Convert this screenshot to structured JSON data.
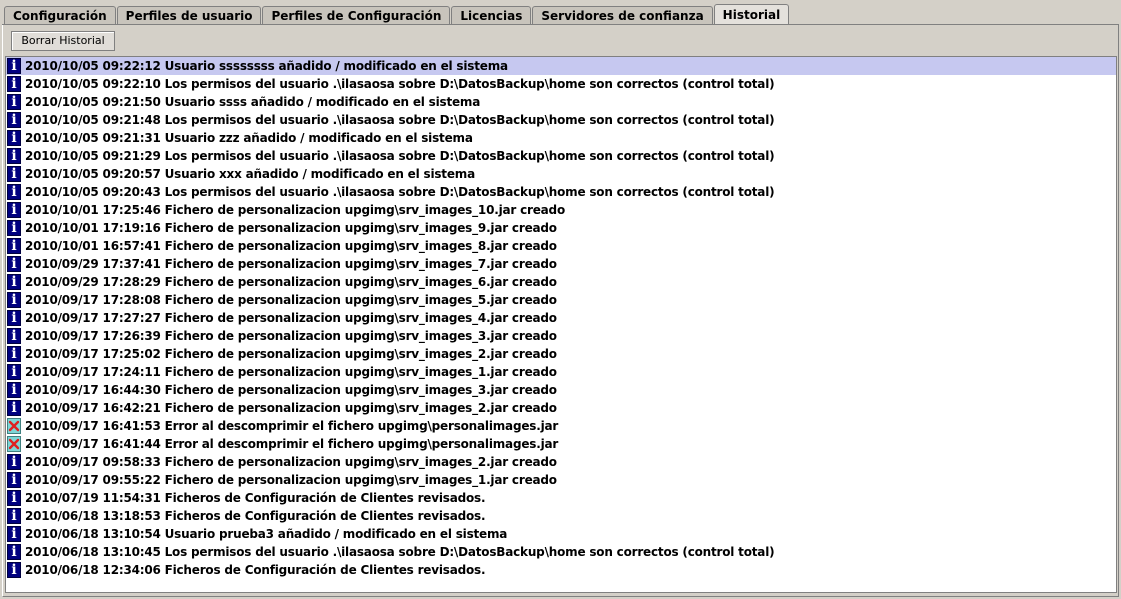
{
  "tabs": [
    {
      "label": "Configuración",
      "active": false
    },
    {
      "label": "Perfiles de usuario",
      "active": false
    },
    {
      "label": "Perfiles de Configuración",
      "active": false
    },
    {
      "label": "Licencias",
      "active": false
    },
    {
      "label": "Servidores de confianza",
      "active": false
    },
    {
      "label": "Historial",
      "active": true
    }
  ],
  "toolbar": {
    "clear_label": "Borrar Historial"
  },
  "icons": {
    "info": "info-icon",
    "error": "error-icon"
  },
  "colors": {
    "info_bg": "#000080",
    "error_bg": "#7ed6d6",
    "error_x": "#e02020",
    "selection": "#c6c8f0"
  },
  "log": [
    {
      "type": "info",
      "text": "2010/10/05 09:22:12 Usuario ssssssss añadido / modificado en el sistema",
      "selected": true
    },
    {
      "type": "info",
      "text": "2010/10/05 09:22:10 Los permisos del usuario .\\ilasaosa sobre D:\\DatosBackup\\home son correctos (control total)"
    },
    {
      "type": "info",
      "text": "2010/10/05 09:21:50 Usuario ssss añadido / modificado en el sistema"
    },
    {
      "type": "info",
      "text": "2010/10/05 09:21:48 Los permisos del usuario .\\ilasaosa sobre D:\\DatosBackup\\home son correctos (control total)"
    },
    {
      "type": "info",
      "text": "2010/10/05 09:21:31 Usuario zzz añadido / modificado en el sistema"
    },
    {
      "type": "info",
      "text": "2010/10/05 09:21:29 Los permisos del usuario .\\ilasaosa sobre D:\\DatosBackup\\home son correctos (control total)"
    },
    {
      "type": "info",
      "text": "2010/10/05 09:20:57 Usuario xxx añadido / modificado en el sistema"
    },
    {
      "type": "info",
      "text": "2010/10/05 09:20:43 Los permisos del usuario .\\ilasaosa sobre D:\\DatosBackup\\home son correctos (control total)"
    },
    {
      "type": "info",
      "text": "2010/10/01 17:25:46 Fichero de personalizacion upgimg\\srv_images_10.jar creado"
    },
    {
      "type": "info",
      "text": "2010/10/01 17:19:16 Fichero de personalizacion upgimg\\srv_images_9.jar creado"
    },
    {
      "type": "info",
      "text": "2010/10/01 16:57:41 Fichero de personalizacion upgimg\\srv_images_8.jar creado"
    },
    {
      "type": "info",
      "text": "2010/09/29 17:37:41 Fichero de personalizacion upgimg\\srv_images_7.jar creado"
    },
    {
      "type": "info",
      "text": "2010/09/29 17:28:29 Fichero de personalizacion upgimg\\srv_images_6.jar creado"
    },
    {
      "type": "info",
      "text": "2010/09/17 17:28:08 Fichero de personalizacion upgimg\\srv_images_5.jar creado"
    },
    {
      "type": "info",
      "text": "2010/09/17 17:27:27 Fichero de personalizacion upgimg\\srv_images_4.jar creado"
    },
    {
      "type": "info",
      "text": "2010/09/17 17:26:39 Fichero de personalizacion upgimg\\srv_images_3.jar creado"
    },
    {
      "type": "info",
      "text": "2010/09/17 17:25:02 Fichero de personalizacion upgimg\\srv_images_2.jar creado"
    },
    {
      "type": "info",
      "text": "2010/09/17 17:24:11 Fichero de personalizacion upgimg\\srv_images_1.jar creado"
    },
    {
      "type": "info",
      "text": "2010/09/17 16:44:30 Fichero de personalizacion upgimg\\srv_images_3.jar creado"
    },
    {
      "type": "info",
      "text": "2010/09/17 16:42:21 Fichero de personalizacion upgimg\\srv_images_2.jar creado"
    },
    {
      "type": "error",
      "text": "2010/09/17 16:41:53 Error al descomprimir el fichero upgimg\\personalimages.jar"
    },
    {
      "type": "error",
      "text": "2010/09/17 16:41:44 Error al descomprimir el fichero upgimg\\personalimages.jar"
    },
    {
      "type": "info",
      "text": "2010/09/17 09:58:33 Fichero de personalizacion upgimg\\srv_images_2.jar creado"
    },
    {
      "type": "info",
      "text": "2010/09/17 09:55:22 Fichero de personalizacion upgimg\\srv_images_1.jar creado"
    },
    {
      "type": "info",
      "text": "2010/07/19 11:54:31 Ficheros de Configuración de Clientes revisados."
    },
    {
      "type": "info",
      "text": "2010/06/18 13:18:53 Ficheros de Configuración de Clientes revisados."
    },
    {
      "type": "info",
      "text": "2010/06/18 13:10:54 Usuario prueba3 añadido / modificado en el sistema"
    },
    {
      "type": "info",
      "text": "2010/06/18 13:10:45 Los permisos del usuario .\\ilasaosa sobre D:\\DatosBackup\\home son correctos (control total)"
    },
    {
      "type": "info",
      "text": "2010/06/18 12:34:06 Ficheros de Configuración de Clientes revisados."
    }
  ]
}
